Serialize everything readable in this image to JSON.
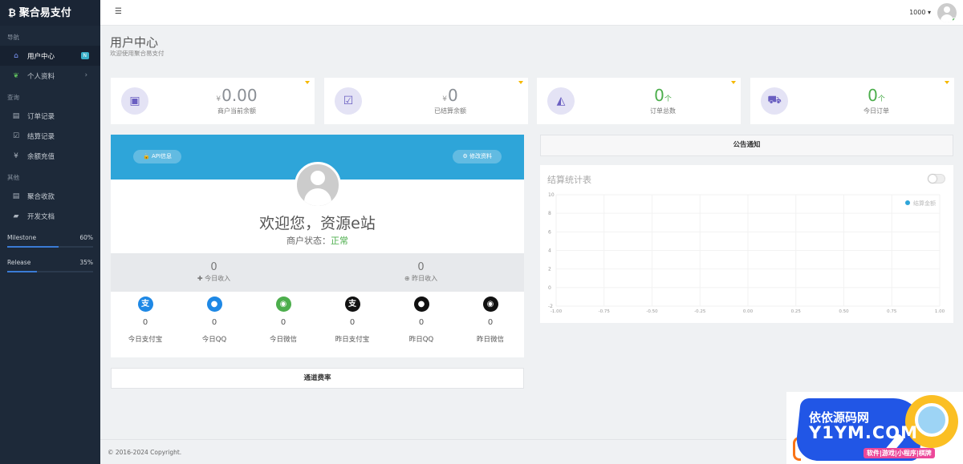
{
  "brand": {
    "icon": "bitcoin-icon",
    "name": "聚合易支付"
  },
  "sidebar": {
    "sections": [
      {
        "title": "导航"
      },
      {
        "title": "查询"
      },
      {
        "title": "其他"
      }
    ],
    "nav": [
      {
        "label": "用户中心",
        "icon": "home-icon",
        "badge": "N",
        "active": true
      },
      {
        "label": "个人资料",
        "icon": "leaf-icon",
        "chevron": "›"
      },
      {
        "label": "订单记录",
        "icon": "list-icon"
      },
      {
        "label": "结算记录",
        "icon": "check-square-icon"
      },
      {
        "label": "余额充值",
        "icon": "yen-icon"
      },
      {
        "label": "聚合收款",
        "icon": "list-icon"
      },
      {
        "label": "开发文档",
        "icon": "book-icon"
      }
    ],
    "progress": [
      {
        "label": "Milestone",
        "value": "60%",
        "fraction": 0.6
      },
      {
        "label": "Release",
        "value": "35%",
        "fraction": 0.35
      }
    ]
  },
  "topbar": {
    "menu_icon": "☰",
    "user_id": "1000 ▾"
  },
  "page": {
    "title": "用户中心",
    "subtitle": "欢迎使用聚合易支付"
  },
  "stats": [
    {
      "icon": "money-icon",
      "prefix": "¥",
      "value": "0.00",
      "label": "商户当前余额"
    },
    {
      "icon": "check-icon",
      "prefix": "¥",
      "value": "0",
      "label": "已结算余额"
    },
    {
      "icon": "area-chart-icon",
      "value": "0",
      "unit": "个",
      "label": "订单总数"
    },
    {
      "icon": "cart-icon",
      "value": "0",
      "unit": "个",
      "label": "今日订单"
    }
  ],
  "profile": {
    "api_button": "API信息",
    "edit_button": "修改资料",
    "welcome": "欢迎您，资源e站",
    "status_label": "商户状态：",
    "status_value": "正常",
    "today_income_value": "0",
    "today_income_label": "今日收入",
    "yesterday_income_value": "0",
    "yesterday_income_label": "昨日收入"
  },
  "payments": [
    {
      "icon": "alipay-icon",
      "value": "0",
      "label": "今日支付宝",
      "color": "#1e88e5"
    },
    {
      "icon": "qq-icon",
      "value": "0",
      "label": "今日QQ",
      "color": "#1e88e5"
    },
    {
      "icon": "wechat-icon",
      "value": "0",
      "label": "今日微信",
      "color": "#4cae4c"
    },
    {
      "icon": "alipay-icon",
      "value": "0",
      "label": "昨日支付宝",
      "color": "#111111"
    },
    {
      "icon": "qq-icon",
      "value": "0",
      "label": "昨日QQ",
      "color": "#111111"
    },
    {
      "icon": "wechat-icon",
      "value": "0",
      "label": "昨日微信",
      "color": "#111111"
    }
  ],
  "rate_panel": {
    "title": "通道费率"
  },
  "notice_panel": {
    "title": "公告通知"
  },
  "chart_data": {
    "type": "line",
    "title": "结算统计表",
    "series": [
      {
        "name": "结算金额",
        "values": []
      }
    ],
    "x_ticks": [
      "-1.00",
      "-0.75",
      "-0.50",
      "-0.25",
      "0.00",
      "0.25",
      "0.50",
      "0.75",
      "1.00"
    ],
    "y_ticks": [
      "10",
      "8",
      "6",
      "4",
      "2",
      "0",
      "-2"
    ],
    "xlim": [
      -1,
      1
    ],
    "ylim": [
      -2,
      10
    ],
    "grid": true,
    "legend": "top-right",
    "color": "#2ea5d9"
  },
  "footer": {
    "copyright": "© 2016-2024 Copyright."
  },
  "watermark": {
    "line1": "依依源码网",
    "line2": "Y1YM.COM",
    "line3": "软件|游戏|小程序|棋牌"
  }
}
